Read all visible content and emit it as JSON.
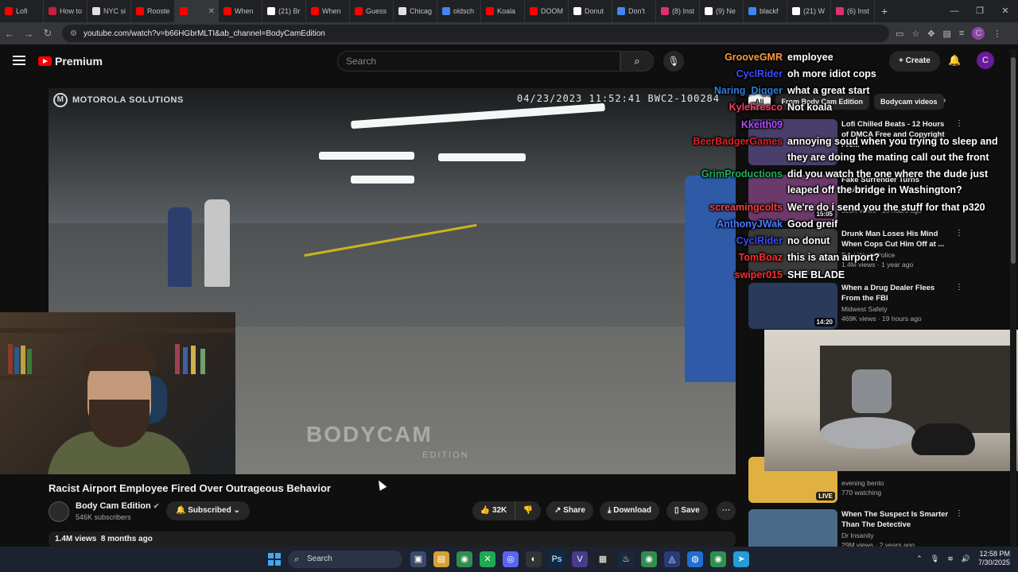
{
  "browser": {
    "tabs": [
      {
        "label": "Lofi",
        "color": "#ff0000"
      },
      {
        "label": "How to",
        "color": "#c71f3d"
      },
      {
        "label": "NYC si",
        "color": "#e0e0e0"
      },
      {
        "label": "Rooste",
        "color": "#ff0000"
      },
      {
        "label": "",
        "color": "#ff0000",
        "active": true
      },
      {
        "label": "When",
        "color": "#ff0000"
      },
      {
        "label": "(21) Br",
        "color": "#ffffff"
      },
      {
        "label": "When",
        "color": "#ff0000"
      },
      {
        "label": "Guess",
        "color": "#ff0000"
      },
      {
        "label": "Chicag",
        "color": "#e0e0e0"
      },
      {
        "label": "oldsch",
        "color": "#4285f4"
      },
      {
        "label": "Koala",
        "color": "#ff0000"
      },
      {
        "label": "DOOM",
        "color": "#ff0000"
      },
      {
        "label": "Donut",
        "color": "#ffffff"
      },
      {
        "label": "Don't",
        "color": "#4285f4"
      },
      {
        "label": "(8) Inst",
        "color": "#e1306c"
      },
      {
        "label": "(9) Ne",
        "color": "#ffffff"
      },
      {
        "label": "blackf",
        "color": "#4285f4"
      },
      {
        "label": "(21) W",
        "color": "#ffffff"
      },
      {
        "label": "(6) Inst",
        "color": "#e1306c"
      }
    ],
    "new_tab": "+",
    "url": "youtube.com/watch?v=b66HGbrMLTI&ab_channel=BodyCamEdition",
    "profile_initial": "C"
  },
  "youtube": {
    "logo_text": "Premium",
    "search_placeholder": "Search",
    "create_label": "Create",
    "avatar_initial": "C"
  },
  "video": {
    "brand": "MOTOROLA SOLUTIONS",
    "timestamp": "04/23/2023 11:52:41 BWC2-100284",
    "watermark": "BODYCAM",
    "watermark_sub": "EDITION",
    "title": "Racist Airport Employee Fired Over Outrageous Behavior",
    "channel": "Body Cam Edition",
    "subscribers": "546K subscribers",
    "subscribed_label": "Subscribed",
    "likes": "32K",
    "share_label": "Share",
    "download_label": "Download",
    "save_label": "Save",
    "views": "1.4M views",
    "age": "8 months ago"
  },
  "chips": [
    {
      "label": "All",
      "selected": true
    },
    {
      "label": "From Body Cam Edition",
      "selected": false
    },
    {
      "label": "Bodycam videos",
      "selected": false
    }
  ],
  "recommendations": [
    {
      "title": "Lofi Chilled Beats - 12 Hours of DMCA Free and Copyright Fre...",
      "channel": "",
      "meta": "",
      "duration": "",
      "thumb": "#4a3f6b"
    },
    {
      "title": "Fake Surrender Turns DEADLY!",
      "channel": "",
      "meta": "320K views · 10 hours ago",
      "duration": "15:05",
      "thumb": "#6b3a6b"
    },
    {
      "title": "Drunk Man Loses His Mind When Cops Cut Him Off at ...",
      "channel": "Real World Police",
      "meta": "1.4M views · 1 year ago",
      "duration": "",
      "thumb": "#3a3a3a"
    },
    {
      "title": "When a Drug Dealer Flees From the FBI",
      "channel": "Midwest Safety",
      "meta": "469K views · 19 hours ago",
      "duration": "14:20",
      "thumb": "#2a3a5a"
    },
    {
      "title": "",
      "channel": "evening bento",
      "meta": "770 watching",
      "duration": "",
      "live": "LIVE",
      "thumb": "#e0b040"
    },
    {
      "title": "When The Suspect Is Smarter Than The Detective",
      "channel": "Dr Insanity",
      "meta": "29M views · 2 years ago",
      "duration": "",
      "thumb": "#4a6a8a"
    }
  ],
  "chat": [
    {
      "user": "GrooveGMR",
      "color": "#ff9a3c",
      "msg": "employee"
    },
    {
      "user": "CyclRider",
      "color": "#3a4bff",
      "msg": "oh more idiot cops"
    },
    {
      "user": "Naring_Digger",
      "color": "#2e7dd6",
      "msg": "what a great start"
    },
    {
      "user": "KyleFresco",
      "color": "#ff3b5c",
      "msg": "Not koala"
    },
    {
      "user": "Kkeith09",
      "color": "#b44dff",
      "msg": ""
    },
    {
      "user": "BeerBadgerGames",
      "color": "#e02020",
      "msg": "annoying soud when you trying to sleep and"
    },
    {
      "user": "",
      "color": "#ffffff",
      "msg": "they are doing the mating call out the front"
    },
    {
      "user": "GrimProductions",
      "color": "#1fb25a",
      "msg": "did you watch the one where the dude just"
    },
    {
      "user": "",
      "color": "#ffffff",
      "msg": "leaped off the bridge in Washington?"
    },
    {
      "user": "screamingcolts",
      "color": "#ff3b3b",
      "msg": "We're do i send you the stuff for that p320"
    },
    {
      "user": "AnthonyJWak",
      "color": "#4a7cff",
      "msg": "Good greif"
    },
    {
      "user": "CyclRider",
      "color": "#3a4bff",
      "msg": "no donut"
    },
    {
      "user": "TomBoaz",
      "color": "#ff2d2d",
      "msg": "this is atan airport?"
    },
    {
      "user": "swiper015",
      "color": "#ff2d2d",
      "msg": "SHE BLADE"
    }
  ],
  "taskbar": {
    "search_label": "Search",
    "time": "12:58 PM",
    "date": "7/30/2025"
  }
}
